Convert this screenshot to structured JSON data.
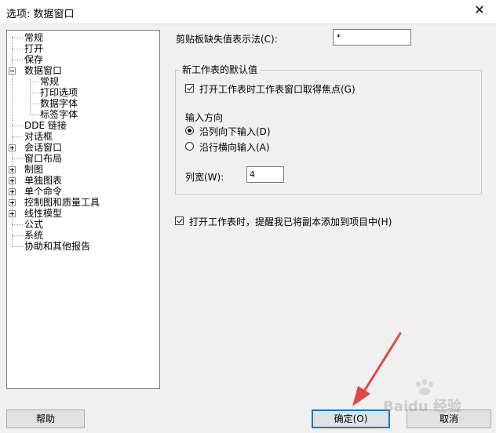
{
  "window": {
    "title": "选项: 数据窗口"
  },
  "tree": {
    "items": [
      {
        "label": "常规"
      },
      {
        "label": "打开"
      },
      {
        "label": "保存"
      },
      {
        "label": "数据窗口"
      },
      {
        "label": "常规"
      },
      {
        "label": "打印选项"
      },
      {
        "label": "数据字体"
      },
      {
        "label": "标签字体"
      },
      {
        "label": "DDE 链接"
      },
      {
        "label": "对话框"
      },
      {
        "label": "会话窗口"
      },
      {
        "label": "窗口布局"
      },
      {
        "label": "制图"
      },
      {
        "label": "单独图表"
      },
      {
        "label": "单个命令"
      },
      {
        "label": "控制图和质量工具"
      },
      {
        "label": "线性模型"
      },
      {
        "label": "公式"
      },
      {
        "label": "系统"
      },
      {
        "label": "协助和其他报告"
      }
    ]
  },
  "clipboard": {
    "label": "剪贴板缺失值表示法(C):",
    "value": "*"
  },
  "defaults": {
    "group_title": "新工作表的默认值",
    "focus_check_label": "打开工作表时工作表窗口取得焦点(G)",
    "direction_label": "输入方向",
    "radio_down": "沿列向下输入(D)",
    "radio_across": "沿行横向输入(A)",
    "width_label": "列宽(W):",
    "width_value": "4"
  },
  "reminder_check_label": "打开工作表时，提醒我已将副本添加到项目中(H)",
  "buttons": {
    "help": "帮助",
    "ok": "确定(O)",
    "cancel": "取消"
  },
  "watermark": {
    "text": "Baidu 经验"
  }
}
